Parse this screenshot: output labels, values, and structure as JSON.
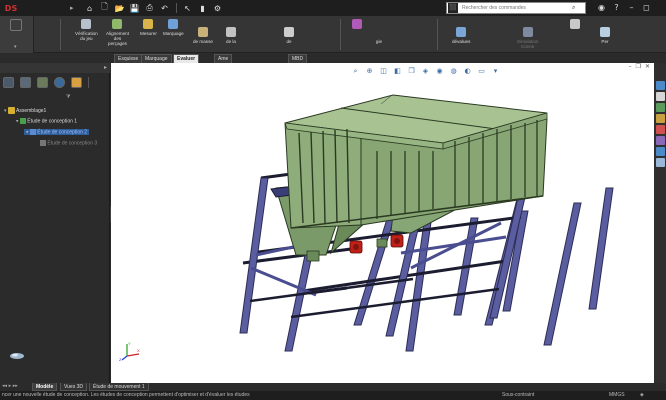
{
  "app": {
    "logo_text": "DS"
  },
  "title_bar": {
    "search": {
      "placeholder": "Rechercher des commandes"
    },
    "icons": [
      "home-icon",
      "new-icon",
      "open-icon",
      "save-icon",
      "print-icon",
      "undo-icon",
      "select-icon",
      "rebuild-icon",
      "options-icon",
      "user-icon",
      "help-icon",
      "minimize-icon",
      "restore-icon"
    ]
  },
  "ribbon": {
    "buttons": [
      {
        "label": "Vérification\ndu jeu",
        "icon": "clearance-check-icon",
        "color": "#b8c0cc"
      },
      {
        "label": "Alignement\ndes\nperçages",
        "icon": "hole-alignment-icon",
        "color": "#8fb86a"
      },
      {
        "label": "Mesurer",
        "icon": "measure-icon",
        "color": "#d8b44a"
      },
      {
        "label": "Marquage",
        "icon": "markup-icon",
        "color": "#6fa0d8"
      },
      {
        "label": "de masse",
        "icon": "mass-properties-icon",
        "color": "#c9b27a"
      },
      {
        "label": "de la",
        "icon": "section-icon",
        "color": "#c2c2c2"
      },
      {
        "label": "de",
        "icon": "sensor-icon",
        "color": "#cccccc"
      },
      {
        "label": "gie",
        "icon": "design-study-icon",
        "color": "#b05bb8"
      },
      {
        "label": "dévalues",
        "icon": "evaluate-icon",
        "color": "#7aa6d6"
      },
      {
        "label": "Simulation\nConne",
        "icon": "simulation-icon",
        "color": "#7e8aa0"
      },
      {
        "label": "Per",
        "icon": "performance-icon",
        "color": "#b7cfe0"
      }
    ]
  },
  "command_tabs": [
    {
      "label": "Esquisse",
      "active": false
    },
    {
      "label": "Marquage",
      "active": false
    },
    {
      "label": "Evaluer",
      "active": true
    },
    {
      "label": "Ame",
      "active": false
    },
    {
      "label": "MBD",
      "active": false
    }
  ],
  "feature_tree": {
    "items": [
      {
        "label": "Assemblage1",
        "icon": "assembly-icon",
        "selected": false
      },
      {
        "label": "Étude de conception 1",
        "icon": "design-study-icon",
        "selected": false
      },
      {
        "label": "Étude de conception 2",
        "icon": "design-study-icon",
        "selected": true
      },
      {
        "label": "Étude de conception 3",
        "icon": "design-study-icon",
        "selected": false
      }
    ]
  },
  "viewport": {
    "document_title": ""
  },
  "bottom_tabs": [
    {
      "label": "Modèle",
      "active": true
    },
    {
      "label": "Vues 3D",
      "active": false
    },
    {
      "label": "Étude de mouvement 1",
      "active": false
    }
  ],
  "status_bar": {
    "message": "ncer une nouvelle étude de conception. Les études de conception permettent d'optimiser et d'évaluer les études",
    "state": "Sous-contraint",
    "units": "MMGS",
    "extra": "◈"
  },
  "colors": {
    "hopper_green": "#8fad7a",
    "frame_blue": "#5a5ea0",
    "motor_red": "#c02018",
    "selection_blue": "#2f5d9a"
  }
}
